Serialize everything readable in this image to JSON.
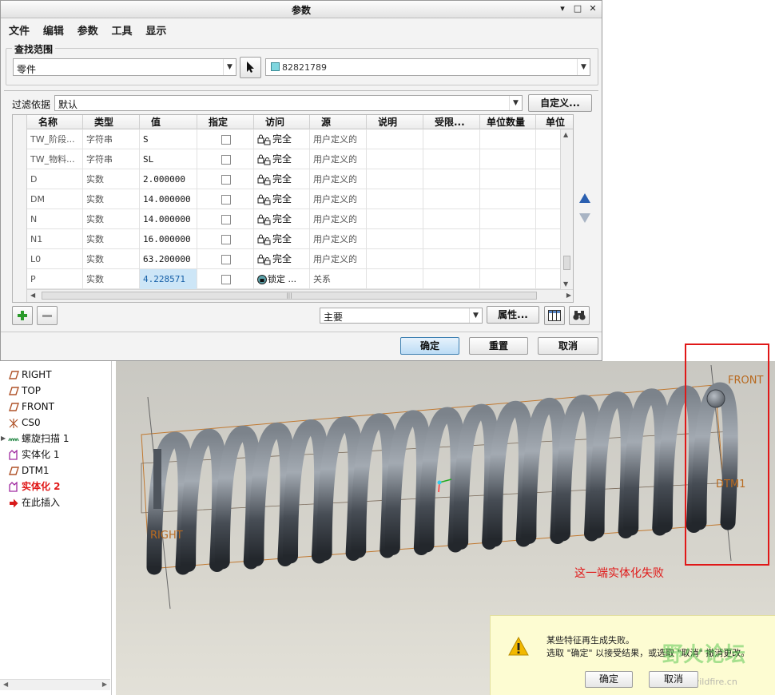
{
  "window": {
    "title": "参数",
    "controls": [
      "▾",
      "□",
      "✕"
    ]
  },
  "menu": [
    "文件",
    "编辑",
    "参数",
    "工具",
    "显示"
  ],
  "scope": {
    "label": "查找范围",
    "type_value": "零件",
    "model_value": "82821789"
  },
  "filter": {
    "label": "过滤依据",
    "value": "默认",
    "customize": "自定义..."
  },
  "table": {
    "columns": [
      "名称",
      "类型",
      "值",
      "指定",
      "访问",
      "源",
      "说明",
      "受限...",
      "单位数量",
      "单位"
    ],
    "rows": [
      {
        "name": "TW_阶段...",
        "type": "字符串",
        "value": "S",
        "access": "完全",
        "source": "用户定义的"
      },
      {
        "name": "TW_物料...",
        "type": "字符串",
        "value": "SL",
        "access": "完全",
        "source": "用户定义的"
      },
      {
        "name": "D",
        "type": "实数",
        "value": "2.000000",
        "access": "完全",
        "source": "用户定义的"
      },
      {
        "name": "DM",
        "type": "实数",
        "value": "14.000000",
        "access": "完全",
        "source": "用户定义的"
      },
      {
        "name": "N",
        "type": "实数",
        "value": "14.000000",
        "access": "完全",
        "source": "用户定义的"
      },
      {
        "name": "N1",
        "type": "实数",
        "value": "16.000000",
        "access": "完全",
        "source": "用户定义的"
      },
      {
        "name": "L0",
        "type": "实数",
        "value": "63.200000",
        "access": "完全",
        "source": "用户定义的"
      },
      {
        "name": "P",
        "type": "实数",
        "value": "4.228571",
        "access": "锁定 ...",
        "source": "关系"
      }
    ]
  },
  "bottom": {
    "main_value": "主要",
    "properties": "属性..."
  },
  "buttons": {
    "ok": "确定",
    "reset": "重置",
    "cancel": "取消"
  },
  "tree": [
    {
      "label": "RIGHT",
      "icon": "datum-plane-icon"
    },
    {
      "label": "TOP",
      "icon": "datum-plane-icon"
    },
    {
      "label": "FRONT",
      "icon": "datum-plane-icon"
    },
    {
      "label": "CS0",
      "icon": "csys-icon"
    },
    {
      "label": "螺旋扫描 1",
      "icon": "helical-sweep-icon"
    },
    {
      "label": "实体化 1",
      "icon": "solidify-icon"
    },
    {
      "label": "DTM1",
      "icon": "datum-plane-icon"
    },
    {
      "label": "实体化 2",
      "icon": "solidify-icon",
      "failed": true
    },
    {
      "label": "在此插入",
      "icon": "insert-here-icon"
    }
  ],
  "viewport": {
    "plane_labels": {
      "front": "FRONT",
      "dtm1": "DTM1",
      "right": "RIGHT"
    },
    "annotation": "这一端实体化失败"
  },
  "notification": {
    "line1": "某些特征再生成失败。",
    "line2": "选取 \"确定\" 以接受结果，或选取 \"取消\" 撤消更改。",
    "ok": "确定",
    "cancel": "取消",
    "watermark": "野火论坛",
    "watermark_url": "www.proewildfire.cn"
  },
  "colors": {
    "annotation_red": "#e01818",
    "selection_blue": "#cde6f7",
    "spring": "#4e545c"
  }
}
